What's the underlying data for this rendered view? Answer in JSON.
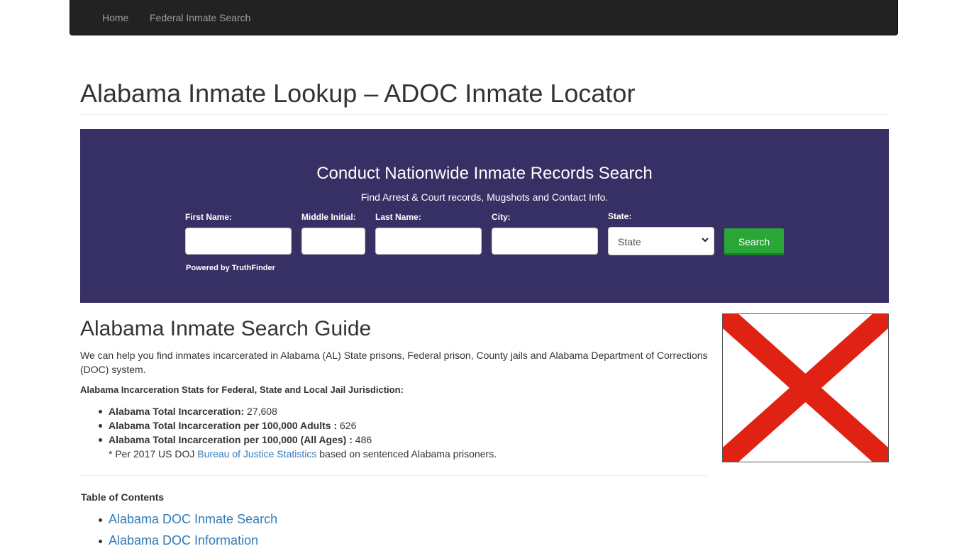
{
  "nav": {
    "home": "Home",
    "federal_search": "Federal Inmate Search"
  },
  "page": {
    "title": "Alabama Inmate Lookup – ADOC Inmate Locator"
  },
  "search_panel": {
    "heading": "Conduct Nationwide Inmate Records Search",
    "subheading": "Find Arrest & Court records, Mugshots and Contact Info.",
    "fields": {
      "first_name": "First Name:",
      "middle_initial": "Middle Initial:",
      "last_name": "Last Name:",
      "city": "City:",
      "state": "State:"
    },
    "state_selected": "State",
    "search_label": "Search",
    "powered_by": "Powered by TruthFinder",
    "colors": {
      "panel_bg": "#373065",
      "button_bg": "#29a736"
    }
  },
  "guide": {
    "heading": "Alabama Inmate Search Guide",
    "intro": "We can help you find inmates incarcerated in Alabama (AL) State prisons, Federal prison, County jails and Alabama Department of Corrections (DOC) system.",
    "stats_heading": "Alabama Incarceration Stats for Federal, State and Local Jail Jurisdiction:",
    "stats": [
      {
        "label": "Alabama Total Incarceration:",
        "value": " 27,608"
      },
      {
        "label": "Alabama Total Incarceration per 100,000 Adults :",
        "value": " 626"
      },
      {
        "label": "Alabama Total Incarceration per 100,000 (All Ages) :",
        "value": " 486"
      }
    ],
    "source_prefix": "* Per 2017 US DOJ ",
    "source_link": "Bureau of Justice Statistics",
    "source_suffix": " based on sentenced Alabama prisoners."
  },
  "toc": {
    "heading": "Table of Contents",
    "items": [
      "Alabama DOC Inmate Search",
      "Alabama DOC Information"
    ]
  },
  "flag": {
    "icon": "alabama-flag",
    "cross_color": "#e02214"
  }
}
